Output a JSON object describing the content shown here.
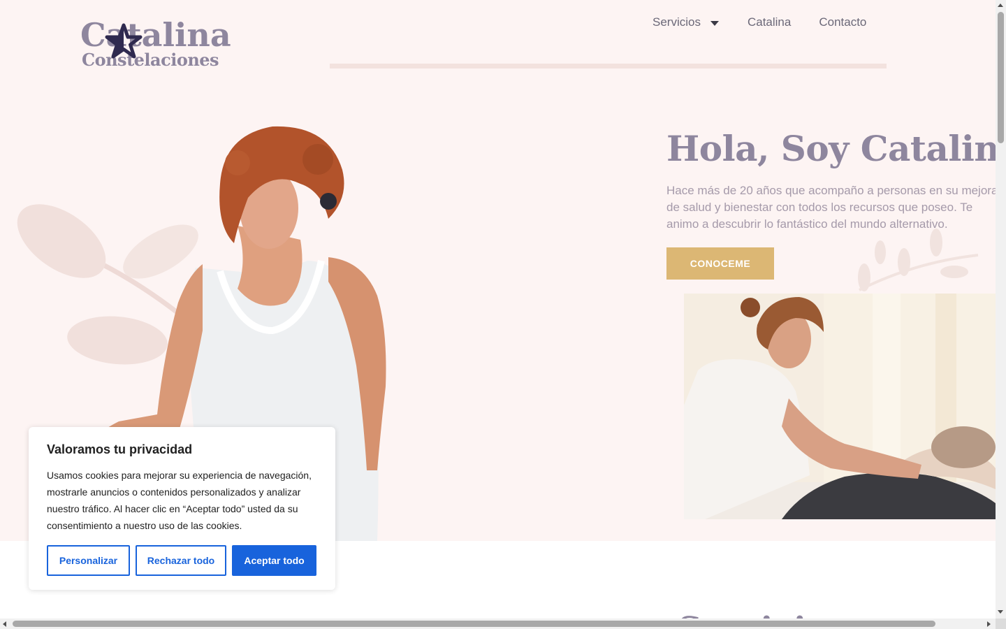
{
  "brand": {
    "name_line1": "Catalina",
    "name_line2": "Constelaciones",
    "star_color": "#2f2a4f",
    "text_color": "#8e869e"
  },
  "nav": {
    "items": [
      {
        "label": "Servicios",
        "has_dropdown": true
      },
      {
        "label": "Catalina"
      },
      {
        "label": "Contacto"
      }
    ]
  },
  "hero": {
    "title": "Hola, Soy Catalina",
    "text": "Hace más de 20 años que acompaño a personas en su mejora de salud y bienestar con todos los recursos que poseo. Te animo a descubrir lo fantástico del mundo alternativo.",
    "cta_label": "CONOCEME",
    "cta_color": "#dcb774",
    "background": "#fdf4f3"
  },
  "section2": {
    "heading": "Servicios"
  },
  "cookie_banner": {
    "title": "Valoramos tu privacidad",
    "text": "Usamos cookies para mejorar su experiencia de navegación, mostrarle anuncios o contenidos personalizados y analizar nuestro tráfico. Al hacer clic en “Aceptar todo” usted da su consentimiento a nuestro uso de las cookies.",
    "buttons": {
      "customize": "Personalizar",
      "reject": "Rechazar todo",
      "accept": "Aceptar todo"
    },
    "accent_color": "#1863dc"
  }
}
